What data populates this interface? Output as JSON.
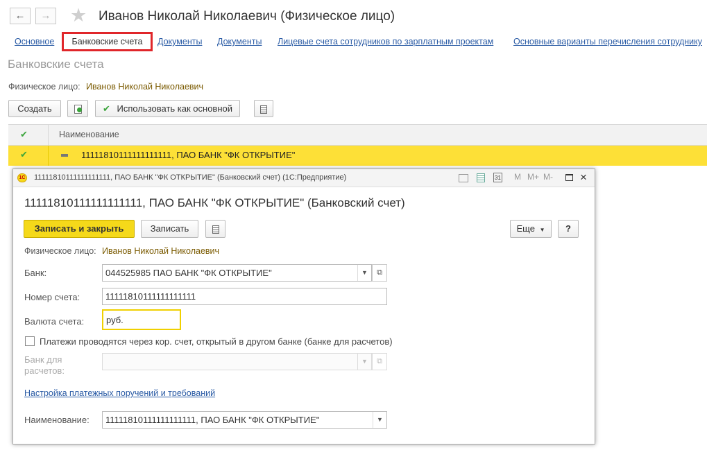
{
  "window": {
    "back_icon": "arrow-left-icon",
    "forward_icon": "arrow-right-icon",
    "star_icon": "star-icon",
    "title": "Иванов Николай Николаевич (Физическое лицо)"
  },
  "tabs": [
    {
      "label": "Основное"
    },
    {
      "label": "Банковские счета"
    },
    {
      "label": "Документы"
    },
    {
      "label": "Документы"
    },
    {
      "label": "Лицевые счета сотрудников по зарплатным проектам"
    },
    {
      "label": "Основные варианты перечисления сотруднику"
    }
  ],
  "section": {
    "title": "Банковские счета",
    "owner_label": "Физическое лицо:",
    "owner_value": "Иванов Николай Николаевич"
  },
  "toolbar": {
    "create_label": "Создать",
    "use_main_label": "Использовать как основной"
  },
  "table": {
    "col_name": "Наименование",
    "rows": [
      {
        "name": "11111810111111111111, ПАО БАНК \"ФК ОТКРЫТИЕ\""
      }
    ]
  },
  "dialog": {
    "window_title": "11111810111111111111, ПАО БАНК \"ФК ОТКРЫТИЕ\" (Банковский счет)  (1С:Предприятие)",
    "heading": "11111810111111111111, ПАО БАНК \"ФК ОТКРЫТИЕ\" (Банковский счет)",
    "app_badge": "1С",
    "save_close_label": "Записать и закрыть",
    "save_label": "Записать",
    "more_label": "Еще",
    "help_label": "?",
    "calendar_day": "31",
    "mem_buttons": [
      "M",
      "M+",
      "M-"
    ],
    "owner_label": "Физическое лицо:",
    "owner_value": "Иванов Николай Николаевич",
    "bank_label": "Банк:",
    "bank_value": "044525985 ПАО БАНК \"ФК ОТКРЫТИЕ\"",
    "account_label": "Номер счета:",
    "account_value": "11111810111111111111",
    "currency_label": "Валюта счета:",
    "currency_value": "руб.",
    "corr_checkbox_label": "Платежи проводятся через кор. счет, открытый в другом банке (банке для расчетов)",
    "settle_bank_label_line1": "Банк для",
    "settle_bank_label_line2": "расчетов:",
    "settle_bank_value": "",
    "payment_settings_link": "Настройка платежных поручений и требований",
    "name_label": "Наименование:",
    "name_value": "11111810111111111111, ПАО БАНК \"ФК ОТКРЫТИЕ\""
  },
  "colors": {
    "accent_yellow": "#f5d91a",
    "selected_row": "#fde037",
    "link_blue": "#2a5ba5",
    "active_tab_border": "#e0262a"
  }
}
